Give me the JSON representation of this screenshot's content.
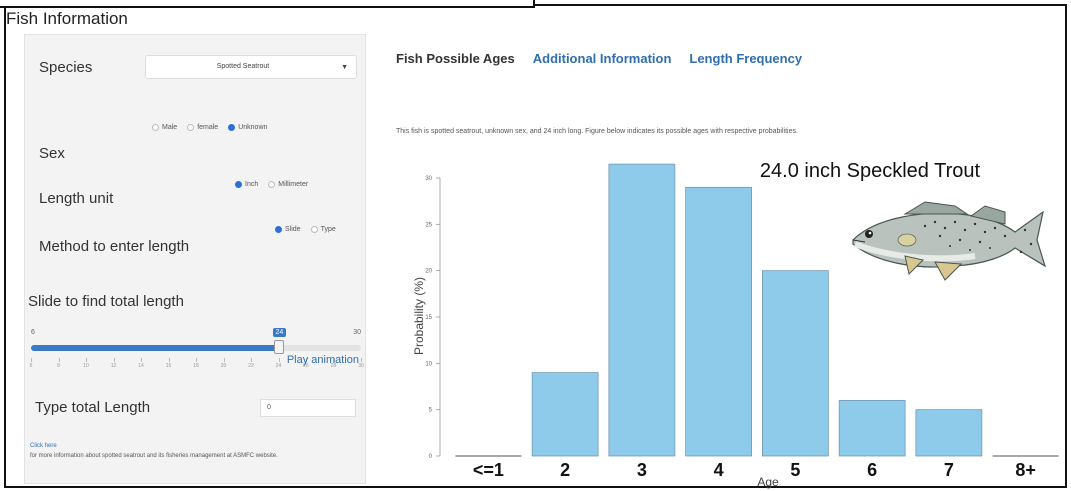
{
  "window": {
    "title": "Fish Information"
  },
  "sidebar": {
    "species": {
      "label": "Species",
      "selected": "Spotted Seatrout"
    },
    "sex": {
      "label": "Sex",
      "options": [
        "Male",
        "female",
        "Unknown"
      ],
      "selected_index": 2
    },
    "length_unit": {
      "label": "Length unit",
      "options": [
        "Inch",
        "Millimeter"
      ],
      "selected_index": 0
    },
    "method": {
      "label": "Method to enter length",
      "options": [
        "Slide",
        "Type"
      ],
      "selected_index": 0
    },
    "slider": {
      "label": "Slide to find total length",
      "min": 6,
      "max": 30,
      "value": 24,
      "min_label": "6",
      "max_label": "30",
      "value_label": "24",
      "play_label": "Play animation"
    },
    "type_length": {
      "label": "Type total Length",
      "value": "0"
    },
    "more_info": {
      "link": "Click here",
      "text": "for more information about spotted seatrout and its fisheries management at ASMFC website."
    }
  },
  "main": {
    "tabs": [
      "Fish Possible Ages",
      "Additional Information",
      "Length Frequency"
    ],
    "active_tab": 0,
    "description": "This fish is spotted seatrout, unknown sex, and 24 inch long. Figure below indicates its possible ages with respective probabilities."
  },
  "chart_data": {
    "type": "bar",
    "title": "24.0 inch Speckled Trout",
    "xlabel": "Age",
    "ylabel": "Probability (%)",
    "categories": [
      "<=1",
      "2",
      "3",
      "4",
      "5",
      "6",
      "7",
      "8+"
    ],
    "values": [
      0,
      9,
      31.5,
      29,
      20,
      6,
      5,
      0
    ],
    "ylim": [
      0,
      30
    ],
    "yticks": [
      0,
      5,
      10,
      15,
      20,
      25,
      30
    ],
    "bar_color": "#8ecbea",
    "grid": false
  },
  "colors": {
    "accent": "#2f6fb0",
    "bar": "#8ecbea"
  },
  "icons": {
    "fish": "speckled-trout-illustration"
  }
}
